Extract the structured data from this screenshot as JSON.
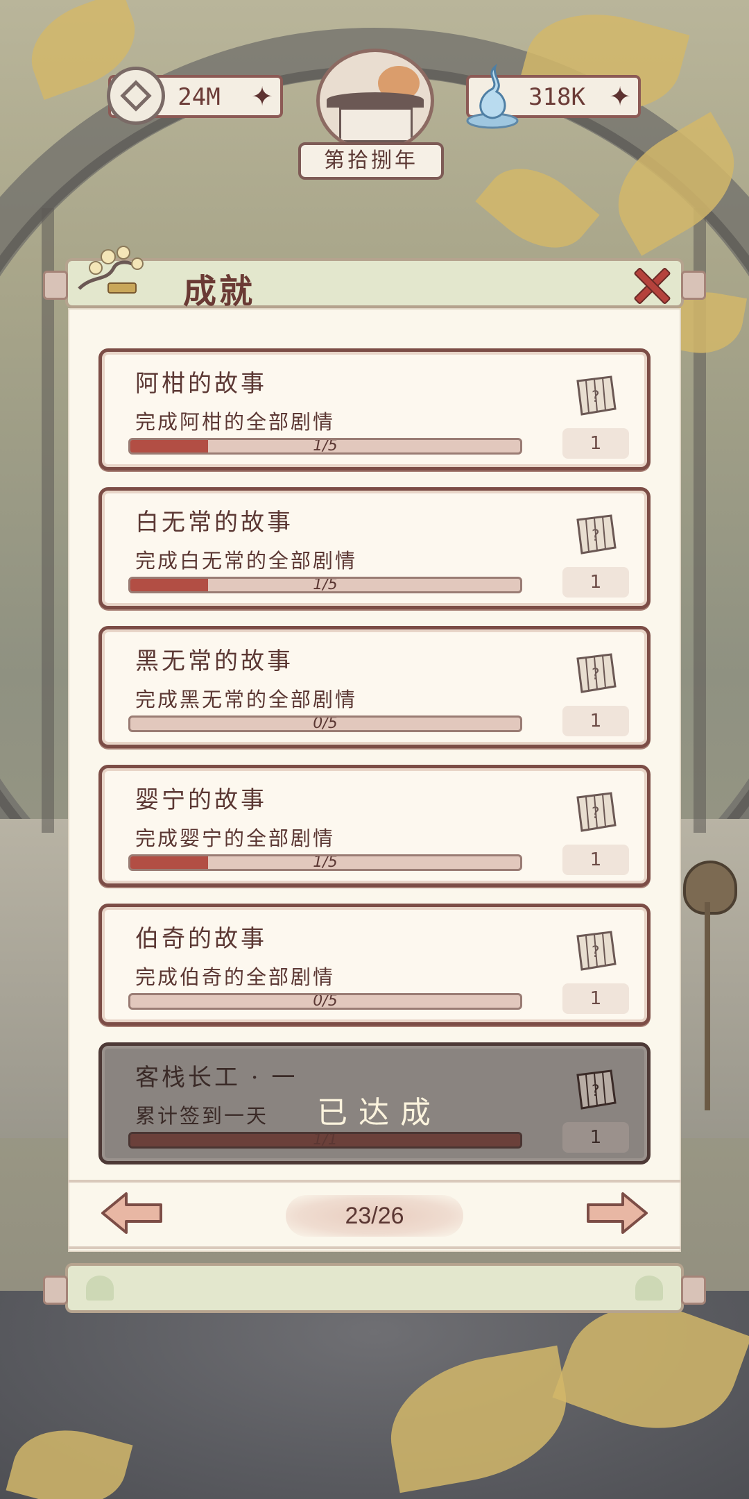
{
  "header": {
    "coins": "24M",
    "water": "318K",
    "year": "第拾捌年"
  },
  "panel": {
    "title": "成就",
    "achievements": [
      {
        "name": "阿柑的故事",
        "desc": "完成阿柑的全部剧情",
        "progress_text": "1/5",
        "progress": 0.2,
        "reward": "1",
        "completed": false
      },
      {
        "name": "白无常的故事",
        "desc": "完成白无常的全部剧情",
        "progress_text": "1/5",
        "progress": 0.2,
        "reward": "1",
        "completed": false
      },
      {
        "name": "黑无常的故事",
        "desc": "完成黑无常的全部剧情",
        "progress_text": "0/5",
        "progress": 0,
        "reward": "1",
        "completed": false
      },
      {
        "name": "婴宁的故事",
        "desc": "完成婴宁的全部剧情",
        "progress_text": "1/5",
        "progress": 0.2,
        "reward": "1",
        "completed": false
      },
      {
        "name": "伯奇的故事",
        "desc": "完成伯奇的全部剧情",
        "progress_text": "0/5",
        "progress": 0,
        "reward": "1",
        "completed": false
      },
      {
        "name": "客栈长工 · 一",
        "desc": "累计签到一天",
        "progress_text": "1/1",
        "progress": 1,
        "reward": "1",
        "completed": true,
        "status_label": "已达成"
      }
    ],
    "page": "23/26"
  },
  "colors": {
    "accent": "#7c4d46",
    "progress_fill": "#b24e44",
    "panel_bg": "#fbf7ec"
  }
}
